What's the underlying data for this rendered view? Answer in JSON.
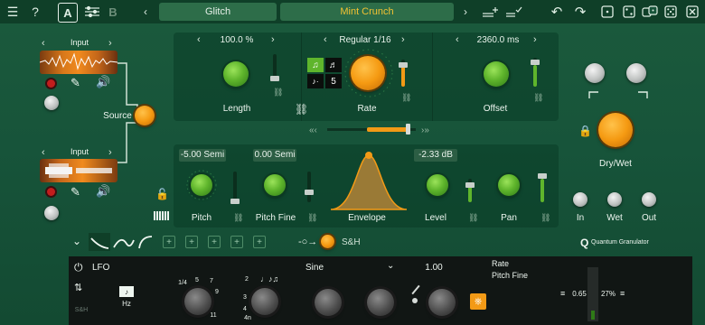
{
  "topbar": {
    "menu_icon": "☰",
    "help_icon": "?",
    "slot_a": "A",
    "slot_b": "B",
    "preset_left": "Glitch",
    "preset_right": "Mint Crunch"
  },
  "source": {
    "input1_label": "Input",
    "input2_label": "Input",
    "source_label": "Source"
  },
  "grain": {
    "length_value": "100.0 %",
    "length_label": "Length",
    "rate_value": "Regular 1/16",
    "rate_label": "Rate",
    "rate_multiplier": "5",
    "offset_value": "2360.0 ms",
    "offset_label": "Offset"
  },
  "pitch": {
    "pitch_value": "-5.00 Semi",
    "pitch_label": "Pitch",
    "pitch_fine_value": "0.00 Semi",
    "pitch_fine_label": "Pitch Fine",
    "envelope_label": "Envelope",
    "level_value": "-2.33 dB",
    "level_label": "Level",
    "pan_label": "Pan"
  },
  "output": {
    "drywet_label": "Dry/Wet",
    "in_label": "In",
    "wet_label": "Wet",
    "out_label": "Out"
  },
  "modbar": {
    "sh_label": "S&H",
    "brand": "Quantum Granulator",
    "brand_mark": "Q"
  },
  "lfo": {
    "title": "LFO",
    "sh_small": "S&H",
    "hz_label": "Hz",
    "shape": "Sine",
    "amount": "1.00",
    "target1": "Rate",
    "target2": "Pitch Fine",
    "value1": "0.65",
    "value2": "27%",
    "scale1": [
      "1/4",
      "5",
      "7",
      "9",
      "11"
    ],
    "scale2": [
      "2",
      "3",
      "4",
      "4n"
    ]
  },
  "colors": {
    "accent_orange": "#f39a16",
    "accent_green": "#5fb52c",
    "bg": "#17543a"
  }
}
